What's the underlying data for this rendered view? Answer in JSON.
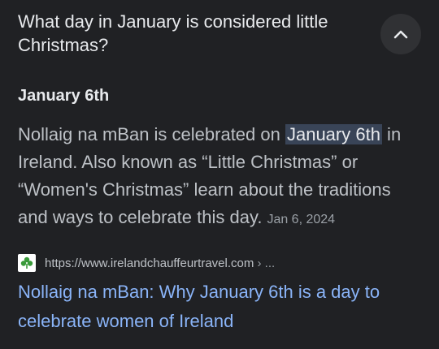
{
  "question": "What day in January is considered little Christmas?",
  "collapse_icon": "chevron-up-icon",
  "answer": {
    "title": "January 6th",
    "snippet_before": "Nollaig na mBan is celebrated on ",
    "snippet_highlight": "January 6th",
    "snippet_after": " in Ireland. Also known as “Little Christmas” or “Women's Christmas” learn about the traditions and ways to celebrate this day.",
    "date": "Jan 6, 2024"
  },
  "source": {
    "favicon_icon": "shamrock-favicon-icon",
    "url": "https://www.irelandchauffeurtravel.com",
    "url_suffix": " › ..."
  },
  "result": {
    "title": "Nollaig na mBan: Why January 6th is a day to celebrate women of Ireland"
  },
  "colors": {
    "background": "#202124",
    "link": "#8ab4f8",
    "highlight": "#394457",
    "button": "#303134"
  }
}
